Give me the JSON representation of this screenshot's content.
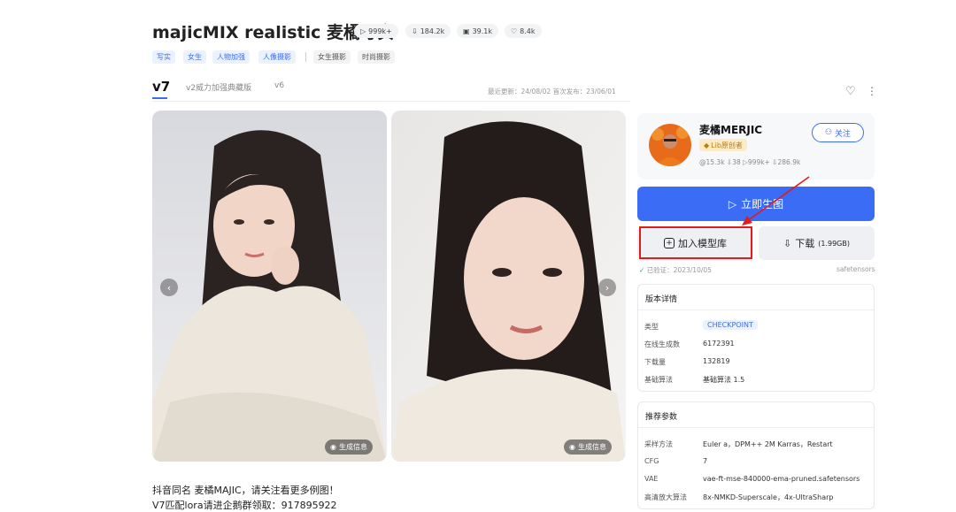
{
  "header": {
    "title": "majicMIX realistic 麦橘写实",
    "stats": [
      {
        "icon": "play-icon",
        "value": "999k+"
      },
      {
        "icon": "download-icon",
        "value": "184.2k"
      },
      {
        "icon": "image-icon",
        "value": "39.1k"
      },
      {
        "icon": "heart-icon",
        "value": "8.4k"
      }
    ],
    "tags_primary": [
      "写实",
      "女生",
      "人物加强",
      "人像摄影"
    ],
    "tags_secondary": [
      "女生摄影",
      "时尚摄影"
    ]
  },
  "versions": {
    "tabs": [
      "v7",
      "v2威力加强典藏版",
      "v6"
    ],
    "active": "v7",
    "dates": "最近更新：24/08/02   首次发布：23/06/01"
  },
  "gallery": {
    "gen_info_label": "生成信息",
    "prev_arrow": "‹",
    "next_arrow": "›"
  },
  "description": {
    "line1": "抖音同名 麦橘MAJIC，请关注看更多例图！",
    "line2": "V7匹配lora请进企鹅群领取：917895922"
  },
  "author": {
    "name": "麦橘MERJIC",
    "badge": "Lib原创者",
    "stats": "@15.3k  ⇩38  ▷999k+  ⇩286.9k",
    "follow_label": "关注"
  },
  "actions": {
    "generate_label": "立即生图",
    "add_label": "加入模型库",
    "download_label": "下载",
    "download_size": "(1.99GB)"
  },
  "verification": {
    "text": "已验证：2023/10/05",
    "format": "safetensors"
  },
  "version_details": {
    "title": "版本详情",
    "rows": [
      {
        "key": "类型",
        "value": "CHECKPOINT"
      },
      {
        "key": "在线生成数",
        "value": "6172391"
      },
      {
        "key": "下载量",
        "value": "132819"
      },
      {
        "key": "基础算法",
        "value": "基础算法 1.5"
      }
    ]
  },
  "recommended": {
    "title": "推荐参数",
    "rows": [
      {
        "key": "采样方法",
        "value": "Euler a，DPM++ 2M Karras，Restart"
      },
      {
        "key": "CFG",
        "value": "7"
      },
      {
        "key": "VAE",
        "value": "vae-ft-mse-840000-ema-pruned.safetensors"
      },
      {
        "key": "高清放大算法",
        "value": "8x-NMKD-Superscale，4x-UltraSharp"
      }
    ]
  },
  "colors": {
    "accent": "#3b6cf5",
    "highlight": "#e41b1b",
    "verified": "#2ca84f"
  }
}
